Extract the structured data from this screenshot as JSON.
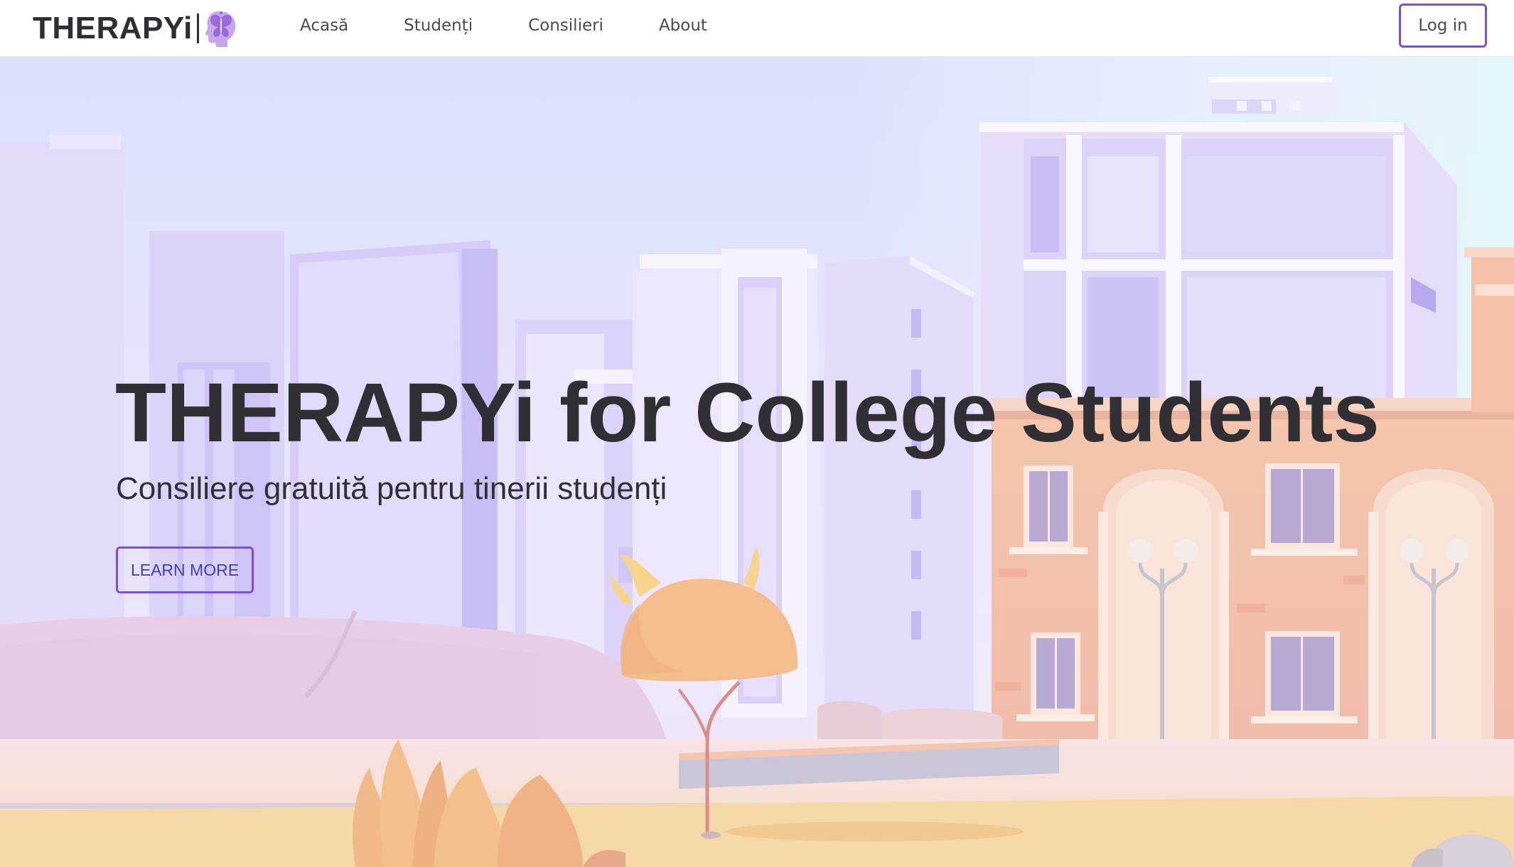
{
  "navbar": {
    "brand": "THERAPYi",
    "brand_logo_icon": "head-butterfly-logo-icon",
    "links": [
      {
        "label": "Acasă"
      },
      {
        "label": "Studenți"
      },
      {
        "label": "Consilieri"
      },
      {
        "label": "About"
      }
    ],
    "login_label": "Log in"
  },
  "hero": {
    "title": "THERAPYi for College Students",
    "subtitle": "Consiliere gratuită pentru tinerii studenți",
    "cta_label": "LEARN MORE",
    "background": "campus-illustration"
  },
  "colors": {
    "accent": "#7e4fd6",
    "cta_text": "#3c3cc8",
    "text_dark": "#2f2f34",
    "nav_text": "#4a4a55",
    "logo_purple": "#b48be0"
  }
}
